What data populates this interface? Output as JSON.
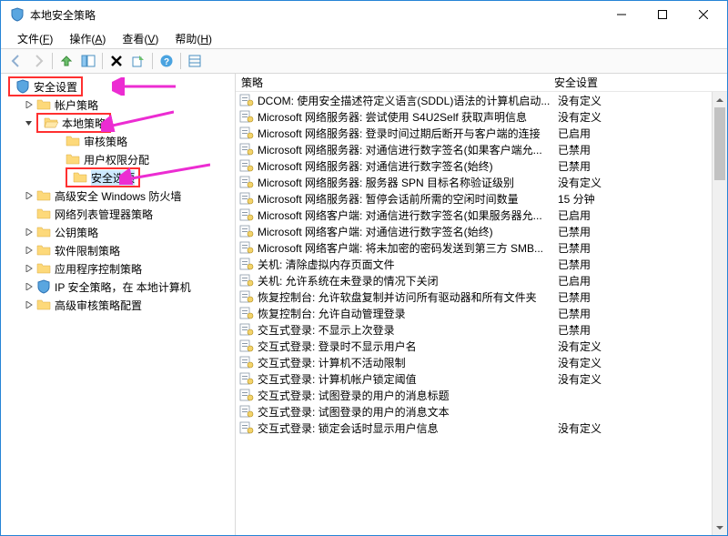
{
  "window": {
    "title": "本地安全策略"
  },
  "menus": {
    "file": "文件(F)",
    "action": "操作(A)",
    "view": "查看(V)",
    "help": "帮助(H)"
  },
  "tree": {
    "root": "安全设置",
    "account": "帐户策略",
    "local": "本地策略",
    "audit": "审核策略",
    "rights": "用户权限分配",
    "options": "安全选项",
    "firewall": "高级安全 Windows 防火墙",
    "netlist": "网络列表管理器策略",
    "pubkey": "公钥策略",
    "softrestrict": "软件限制策略",
    "appctrl": "应用程序控制策略",
    "ipsec": "IP 安全策略，在 本地计算机",
    "advaudit": "高级审核策略配置"
  },
  "cols": {
    "policy": "策略",
    "setting": "安全设置"
  },
  "rows": [
    {
      "p": "DCOM: 使用安全描述符定义语言(SDDL)语法的计算机启动...",
      "s": "没有定义"
    },
    {
      "p": "Microsoft 网络服务器: 尝试使用 S4U2Self 获取声明信息",
      "s": "没有定义"
    },
    {
      "p": "Microsoft 网络服务器: 登录时间过期后断开与客户端的连接",
      "s": "已启用"
    },
    {
      "p": "Microsoft 网络服务器: 对通信进行数字签名(如果客户端允...",
      "s": "已禁用"
    },
    {
      "p": "Microsoft 网络服务器: 对通信进行数字签名(始终)",
      "s": "已禁用"
    },
    {
      "p": "Microsoft 网络服务器: 服务器 SPN 目标名称验证级别",
      "s": "没有定义"
    },
    {
      "p": "Microsoft 网络服务器: 暂停会话前所需的空闲时间数量",
      "s": "15 分钟"
    },
    {
      "p": "Microsoft 网络客户端: 对通信进行数字签名(如果服务器允...",
      "s": "已启用"
    },
    {
      "p": "Microsoft 网络客户端: 对通信进行数字签名(始终)",
      "s": "已禁用"
    },
    {
      "p": "Microsoft 网络客户端: 将未加密的密码发送到第三方 SMB...",
      "s": "已禁用"
    },
    {
      "p": "关机: 清除虚拟内存页面文件",
      "s": "已禁用"
    },
    {
      "p": "关机: 允许系统在未登录的情况下关闭",
      "s": "已启用"
    },
    {
      "p": "恢复控制台: 允许软盘复制并访问所有驱动器和所有文件夹",
      "s": "已禁用"
    },
    {
      "p": "恢复控制台: 允许自动管理登录",
      "s": "已禁用"
    },
    {
      "p": "交互式登录: 不显示上次登录",
      "s": "已禁用"
    },
    {
      "p": "交互式登录: 登录时不显示用户名",
      "s": "没有定义"
    },
    {
      "p": "交互式登录: 计算机不活动限制",
      "s": "没有定义"
    },
    {
      "p": "交互式登录: 计算机帐户锁定阈值",
      "s": "没有定义"
    },
    {
      "p": "交互式登录: 试图登录的用户的消息标题",
      "s": ""
    },
    {
      "p": "交互式登录: 试图登录的用户的消息文本",
      "s": ""
    },
    {
      "p": "交互式登录: 锁定会话时显示用户信息",
      "s": "没有定义"
    }
  ]
}
